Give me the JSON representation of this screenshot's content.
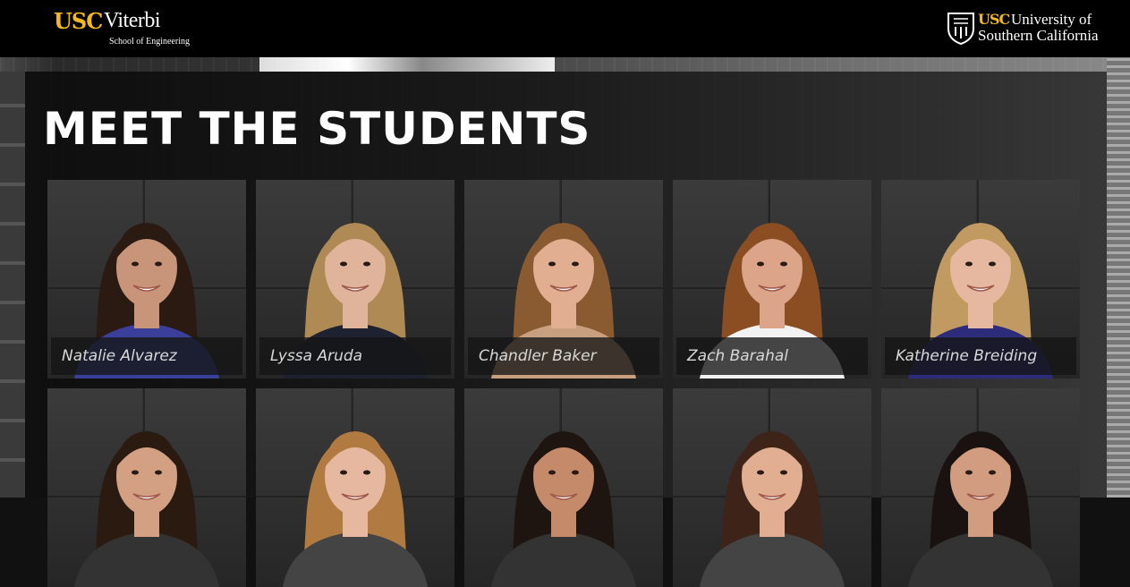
{
  "header": {
    "left_logo": {
      "brand": "USC",
      "name": "Viterbi",
      "subtitle": "School of Engineering"
    },
    "right_logo": {
      "brand": "USC",
      "line1": "University of",
      "line2": "Southern California",
      "seal_icon": "usc-seal-icon"
    }
  },
  "page": {
    "title": "MEET THE STUDENTS"
  },
  "colors": {
    "brand_gold": "#f3b81f",
    "header_bg": "#000000",
    "panel_bg": "#141414"
  },
  "students": [
    {
      "name": "Natalie Alvarez",
      "hair": "#2a1a12",
      "skin": "#c8957a",
      "shirt": "#3a3f9a"
    },
    {
      "name": "Lyssa Aruda",
      "hair": "#b08a55",
      "skin": "#e0b49a",
      "shirt": "#1e2230"
    },
    {
      "name": "Chandler Baker",
      "hair": "#8a5a30",
      "skin": "#e2ae92",
      "shirt": "#c8a080"
    },
    {
      "name": "Zach Barahal",
      "hair": "#8a4e22",
      "skin": "#dca488",
      "shirt": "#f2f2f2"
    },
    {
      "name": "Katherine Breiding",
      "hair": "#c09a60",
      "skin": "#e6b8a0",
      "shirt": "#2c2c7a"
    },
    {
      "name": "",
      "hair": "#2a1a10",
      "skin": "#d4a084",
      "shirt": "#333333"
    },
    {
      "name": "",
      "hair": "#b07a40",
      "skin": "#e6b8a0",
      "shirt": "#444444"
    },
    {
      "name": "",
      "hair": "#1e1410",
      "skin": "#c48a6a",
      "shirt": "#333333"
    },
    {
      "name": "",
      "hair": "#3e2418",
      "skin": "#e2ae92",
      "shirt": "#444444"
    },
    {
      "name": "",
      "hair": "#1a1210",
      "skin": "#d29c80",
      "shirt": "#333333"
    }
  ]
}
